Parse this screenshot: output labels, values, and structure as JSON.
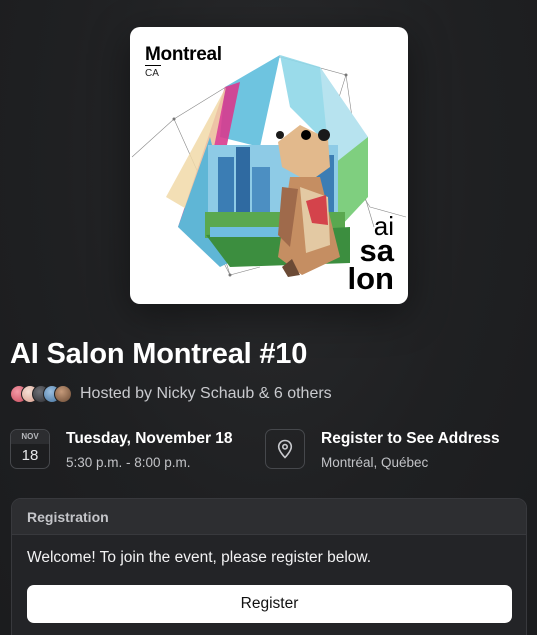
{
  "event": {
    "cover": {
      "city": "Montreal",
      "country": "CA",
      "brand_line1": "ai",
      "brand_line2": "sa",
      "brand_line3": "lon"
    },
    "title": "AI Salon Montreal #10",
    "hosted_by": "Hosted by Nicky Schaub & 6 others",
    "host_avatars": [
      "avatar-red",
      "avatar-pink",
      "avatar-dark",
      "avatar-blue",
      "avatar-brown"
    ],
    "date": {
      "month": "NOV",
      "day": "18",
      "full_date": "Tuesday, November 18",
      "time": "5:30 p.m. - 8:00 p.m."
    },
    "location": {
      "icon": "map-pin-icon",
      "title": "Register to See Address",
      "city": "Montréal, Québec"
    },
    "registration": {
      "header": "Registration",
      "welcome": "Welcome! To join the event, please register below.",
      "button_label": "Register"
    }
  },
  "colors": {
    "background": "#1c1d1f",
    "card": "#232427",
    "button": "#ffffff"
  }
}
